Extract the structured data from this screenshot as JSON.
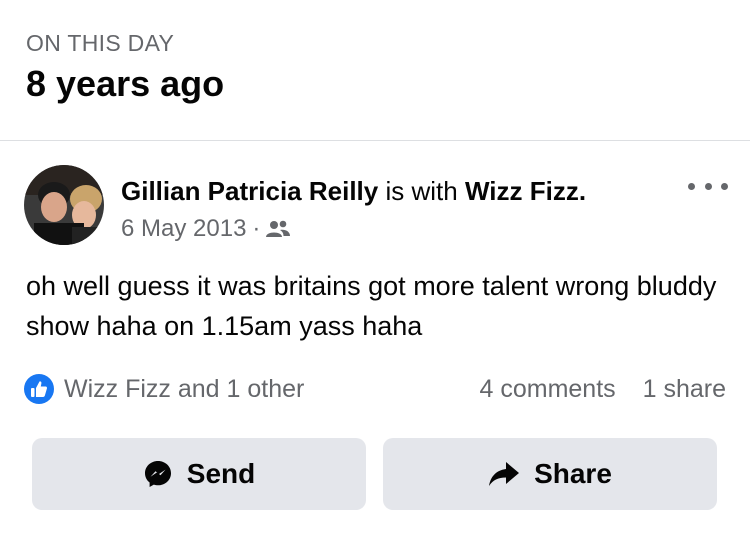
{
  "memory": {
    "label": "ON THIS DAY",
    "ago": "8 years ago"
  },
  "post": {
    "author": "Gillian Patricia Reilly",
    "with_text": "is with",
    "tagged": "Wizz Fizz.",
    "date": "6 May 2013",
    "separator": "·",
    "audience_icon": "friends-icon",
    "text": "oh well guess it was britains got more talent wrong bluddy show haha on 1.15am yass haha",
    "menu_icon": "more-options-icon"
  },
  "engagement": {
    "reactions_text": "Wizz Fizz and 1 other",
    "comments": "4 comments",
    "shares": "1 share",
    "reaction_icon": "like-icon"
  },
  "actions": {
    "send_label": "Send",
    "send_icon": "messenger-icon",
    "share_label": "Share",
    "share_icon": "share-arrow-icon"
  },
  "colors": {
    "like_blue": "#1877f2",
    "button_gray": "#e4e6eb",
    "secondary_text": "#65676b"
  }
}
